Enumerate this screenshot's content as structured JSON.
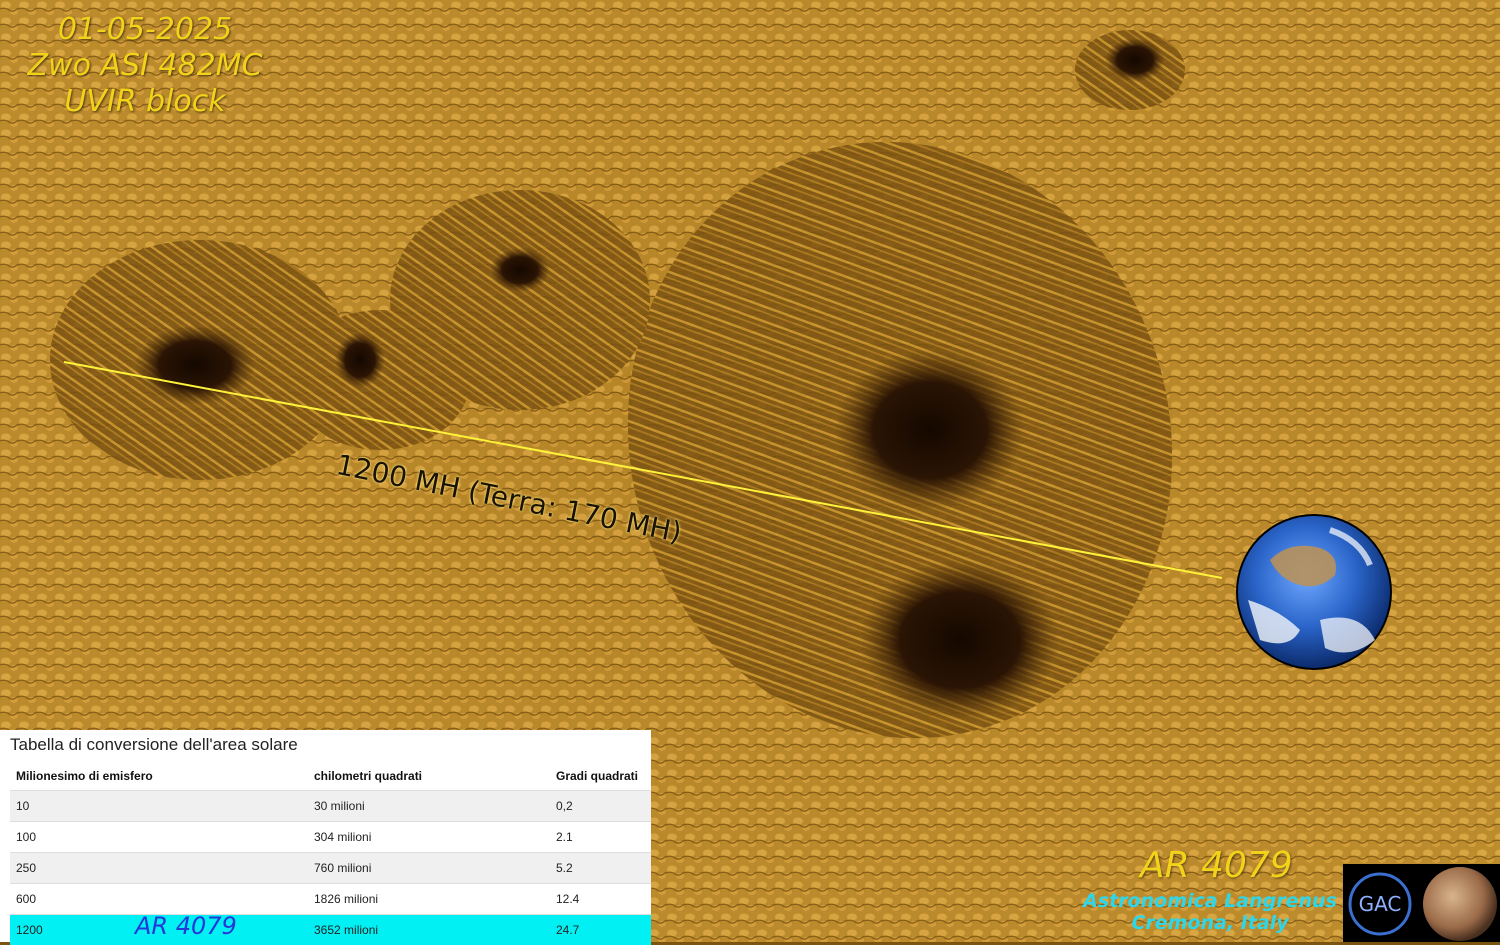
{
  "image_caption": {
    "date": "01-05-2025",
    "camera": "Zwo ASI 482MC",
    "filter": "UVIR block"
  },
  "measurement": {
    "label": "1200 MH (Terra: 170 MH)",
    "line_color": "#fff23a"
  },
  "region": {
    "title": "AR 4079",
    "organization": "Astronomica Langrenus",
    "location": "Cremona, Italy"
  },
  "colors": {
    "photosphere": "#b07a1c",
    "umbra": "#1a0c02",
    "caption_yellow": "#f3d21a",
    "org_cyan": "#2fd6e8",
    "highlight_row": "#00f0f4",
    "row_tag_blue": "#2637d8"
  },
  "icons": {
    "earth": "earth-globe-icon",
    "logo_left": "gac-logo-icon",
    "logo_right": "moon-logo-icon"
  },
  "conversion_table": {
    "title": "Tabella di conversione dell'area solare",
    "headers": [
      "Milionesimo di emisfero",
      "chilometri quadrati",
      "Gradi quadrati"
    ],
    "rows": [
      [
        "10",
        "30 milioni",
        "0,2"
      ],
      [
        "100",
        "304 milioni",
        "2.1"
      ],
      [
        "250",
        "760 milioni",
        "5.2"
      ],
      [
        "600",
        "1826 milioni",
        "12.4"
      ],
      [
        "1200",
        "3652 milioni",
        "24.7"
      ]
    ],
    "highlight_row_tag": "AR 4079"
  }
}
